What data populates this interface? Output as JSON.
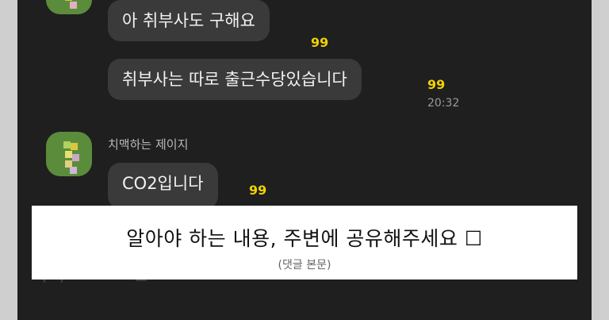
{
  "messages": [
    {
      "text": "아 취부사도 구해요",
      "count": "99"
    },
    {
      "text": "취부사는 따로 출근수당있습니다",
      "count": "99",
      "time": "20:32"
    },
    {
      "sender": "치맥하는 제이지",
      "text": "CO2입니다",
      "count": "99"
    }
  ],
  "caption": {
    "main": "알아야 하는 내용, 주변에 공유해주세요 ☐",
    "sub": "(댓글 본문)"
  },
  "partial_text": "마 떠 ㅆ ᄃ ᄃ ᄃ 보 ᄋ"
}
